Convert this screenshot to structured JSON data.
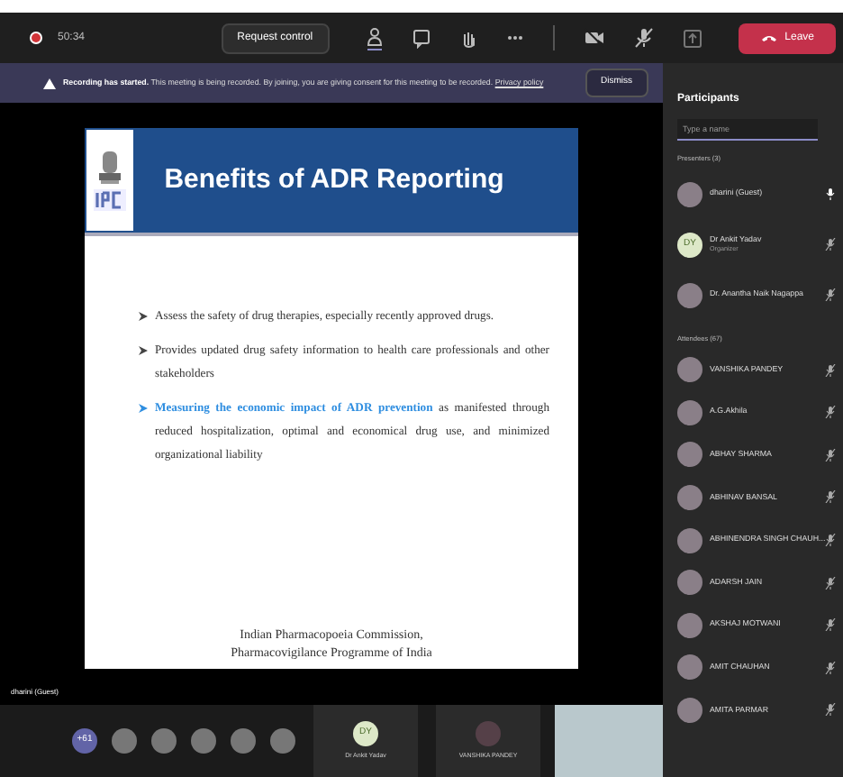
{
  "top_bar": {
    "timer": "50:34",
    "request_button": "Request control",
    "leave_button": "Leave",
    "recording": true
  },
  "banner": {
    "title": "Recording has started.",
    "message": "This meeting is being recorded. By joining, you are giving consent for this meeting to be recorded.",
    "link": "Privacy policy",
    "dismiss": "Dismiss"
  },
  "slide": {
    "title": "Benefits of ADR Reporting",
    "bullets": [
      {
        "text": "Assess the safety of drug therapies, especially recently approved drugs.",
        "highlight": false
      },
      {
        "text": "Provides updated drug safety information to health care professionals and other stakeholders",
        "highlight": false
      },
      {
        "text": "Measuring the economic impact of ADR prevention",
        "rest": " as manifested through reduced hospitalization, optimal and economical drug use, and minimized organizational liability",
        "highlight": true
      }
    ],
    "footer": "Indian Pharmacopoeia Commission, Pharmacovigilance Programme of India"
  },
  "stage_label": "dharini (Guest)",
  "participants": {
    "title": "Participants",
    "search_placeholder": "Type a name",
    "groups": [
      {
        "label": "Presenters (3)",
        "people": [
          {
            "name": "dharini (Guest)",
            "muted": false
          },
          {
            "name": "Dr Ankit Yadav",
            "role": "Organizer",
            "initials": "DY",
            "muted": true
          },
          {
            "name": "Dr. Anantha Naik Nagappa",
            "muted": true
          }
        ]
      },
      {
        "label": "Attendees (67)",
        "people": [
          {
            "name": "VANSHIKA PANDEY",
            "muted": true
          },
          {
            "name": "A.G.Akhila",
            "muted": true
          },
          {
            "name": "ABHAY SHARMA",
            "muted": true
          },
          {
            "name": "ABHINAV BANSAL",
            "muted": true
          },
          {
            "name": "ABHINENDRA SINGH CHAUH...",
            "muted": true
          },
          {
            "name": "ADARSH JAIN",
            "muted": true
          },
          {
            "name": "AKSHAJ MOTWANI",
            "muted": true
          },
          {
            "name": "AMIT CHAUHAN",
            "muted": true
          },
          {
            "name": "AMITA PARMAR",
            "muted": true
          }
        ]
      }
    ]
  },
  "gallery": {
    "overflow": "+61",
    "tiles": [
      {
        "name": "Dr Ankit Yadav",
        "initials": "DY"
      },
      {
        "name": "VANSHIKA PANDEY"
      }
    ]
  }
}
